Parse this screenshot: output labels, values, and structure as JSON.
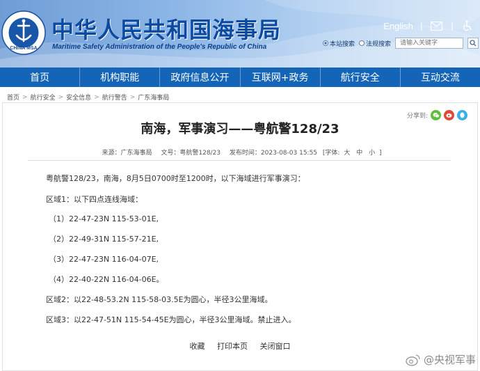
{
  "header": {
    "title": "中华人民共和国海事局",
    "subtitle": "Maritime Safety Administration of the People's Republic of China",
    "lang_link": "English",
    "logo_text": "CHINA MSA",
    "logo_top_text": "中华人民共和国海事局",
    "search": {
      "radio_site": "本站搜索",
      "radio_law": "法规搜索",
      "placeholder": "请输入关键字"
    }
  },
  "nav": {
    "items": [
      "首页",
      "机构职能",
      "政府信息公开",
      "互联网+政务",
      "航行安全",
      "互动交流"
    ]
  },
  "breadcrumb": [
    "首页",
    "航行安全",
    "安全信息",
    "航行警告",
    "广东海事局"
  ],
  "share": {
    "label": "分享到:"
  },
  "article": {
    "title": "南海，军事演习——粤航警128/23",
    "meta": {
      "source": "来源：广东海事局",
      "doc_no": "文号：粤航警128/23",
      "published": "发布时间：2023-08-03 15:55",
      "font_label": "[字体:",
      "font_large": "大",
      "font_mid": "中",
      "font_small": "小",
      "font_close": "]"
    },
    "paragraphs": [
      "粤航警128/23，南海，8月5日0700时至1200时，以下海域进行军事演习：",
      "区域1：以下四点连线海域：",
      "（1）22-47-23N 115-53-01E,",
      "（2）22-49-31N 115-57-21E,",
      "（3）22-47-23N 116-04-07E,",
      "（4）22-40-22N 116-04-06E。",
      "区域2：以22-48-53.2N 115-58-03.5E为圆心，半径3公里海域。",
      "区域3：以22-47-51N 115-54-45E为圆心，半径3公里海域。禁止进入。"
    ]
  },
  "footer_links": {
    "favorite": "收藏",
    "print": "打印本页",
    "close": "关闭窗口"
  },
  "watermark": {
    "text": "@央视军事"
  },
  "colors": {
    "nav_bg": "#1465b8",
    "title_blue": "#0b4aa0"
  }
}
